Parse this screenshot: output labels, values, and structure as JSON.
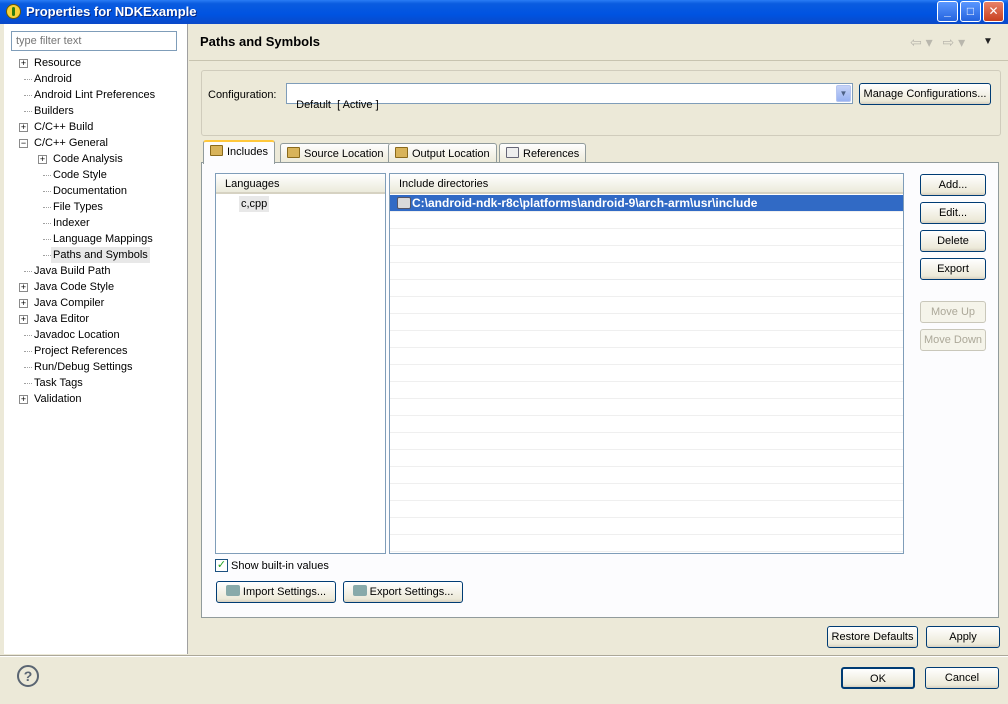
{
  "window": {
    "title": "Properties for NDKExample",
    "minimize_glyph": "_",
    "maximize_glyph": "□",
    "close_glyph": "✕"
  },
  "filter": {
    "placeholder": "type filter text"
  },
  "tree": [
    {
      "label": "Resource",
      "level": 0,
      "expander": "+"
    },
    {
      "label": "Android",
      "level": 0
    },
    {
      "label": "Android Lint Preferences",
      "level": 0
    },
    {
      "label": "Builders",
      "level": 0
    },
    {
      "label": "C/C++ Build",
      "level": 0,
      "expander": "+"
    },
    {
      "label": "C/C++ General",
      "level": 0,
      "expander": "−"
    },
    {
      "label": "Code Analysis",
      "level": 1,
      "expander": "+"
    },
    {
      "label": "Code Style",
      "level": 1
    },
    {
      "label": "Documentation",
      "level": 1
    },
    {
      "label": "File Types",
      "level": 1
    },
    {
      "label": "Indexer",
      "level": 1
    },
    {
      "label": "Language Mappings",
      "level": 1
    },
    {
      "label": "Paths and Symbols",
      "level": 1,
      "selected": true
    },
    {
      "label": "Java Build Path",
      "level": 0
    },
    {
      "label": "Java Code Style",
      "level": 0,
      "expander": "+"
    },
    {
      "label": "Java Compiler",
      "level": 0,
      "expander": "+"
    },
    {
      "label": "Java Editor",
      "level": 0,
      "expander": "+"
    },
    {
      "label": "Javadoc Location",
      "level": 0
    },
    {
      "label": "Project References",
      "level": 0
    },
    {
      "label": "Run/Debug Settings",
      "level": 0
    },
    {
      "label": "Task Tags",
      "level": 0
    },
    {
      "label": "Validation",
      "level": 0,
      "expander": "+"
    }
  ],
  "page": {
    "title": "Paths and Symbols",
    "nav_back": "⇦ ▾",
    "nav_forward": "⇨ ▾",
    "menu": "▼"
  },
  "configuration": {
    "label": "Configuration:",
    "value": "Default  [ Active ]",
    "manage_button": "Manage Configurations..."
  },
  "tabs": [
    {
      "label": "Includes",
      "active": true
    },
    {
      "label": "Source Location"
    },
    {
      "label": "Output Location"
    },
    {
      "label": "References"
    }
  ],
  "languages": {
    "header": "Languages",
    "items": [
      "c,cpp"
    ]
  },
  "includes": {
    "header": "Include directories",
    "items": [
      "C:\\android-ndk-r8c\\platforms\\android-9\\arch-arm\\usr\\include"
    ]
  },
  "side_buttons": {
    "add": "Add...",
    "edit": "Edit...",
    "delete": "Delete",
    "export": "Export",
    "move_up": "Move Up",
    "move_down": "Move Down"
  },
  "show_builtin": {
    "label": "Show built-in values",
    "checked": true,
    "glyph": "✓"
  },
  "settings_buttons": {
    "import": "Import Settings...",
    "export": "Export Settings..."
  },
  "footer": {
    "restore_defaults": "Restore Defaults",
    "apply": "Apply",
    "ok": "OK",
    "cancel": "Cancel",
    "help_glyph": "?"
  },
  "colors": {
    "selection": "#316ac5",
    "titlebar": "#0053e1",
    "tab_highlight": "#ffc83c"
  }
}
